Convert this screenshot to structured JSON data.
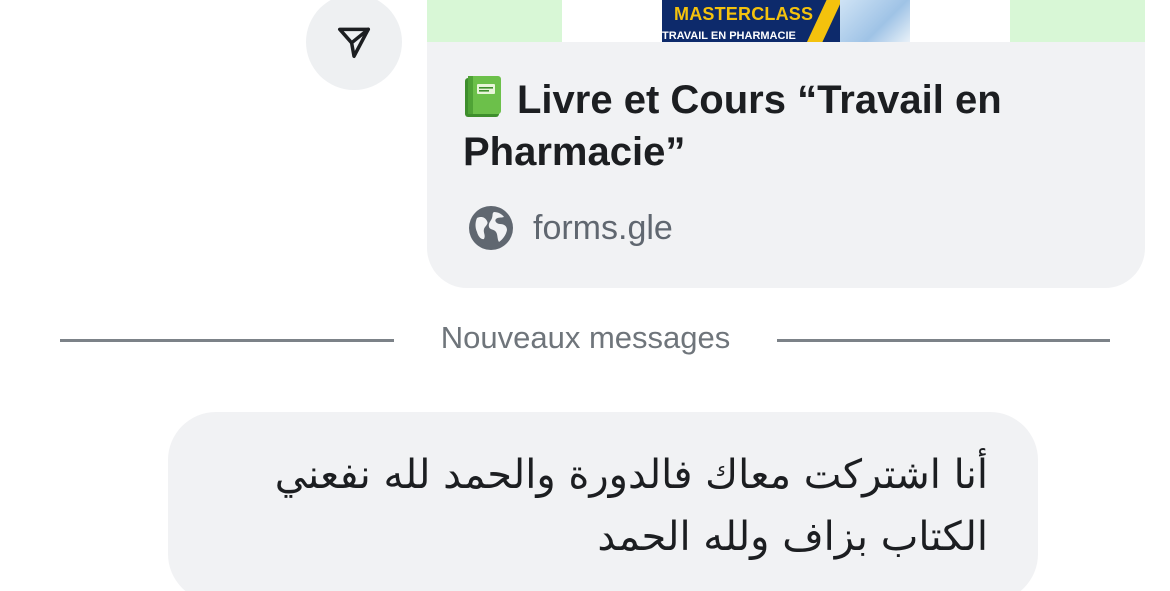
{
  "share_button": {
    "icon": "send-icon"
  },
  "link_card": {
    "thumbnail": {
      "poster_title": "MASTERCLASS",
      "poster_subtitle": "TRAVAIL EN PHARMACIE"
    },
    "title_icon": "green-book-icon",
    "title": "Livre et Cours “Travail en Pharmacie”",
    "domain_icon": "globe-icon",
    "domain": "forms.gle"
  },
  "divider": {
    "label": "Nouveaux messages"
  },
  "message": {
    "text": "أنا اشتركت معاك فالدورة والحمد لله نفعني الكتاب بزاف ولله الحمد"
  },
  "colors": {
    "bubble_bg": "#f1f2f4",
    "text": "#1c1e21",
    "secondary_text": "#606770",
    "thumbnail_green": "#d8f7d6",
    "poster_navy": "#0d2a6b",
    "poster_yellow": "#f4c20d"
  }
}
